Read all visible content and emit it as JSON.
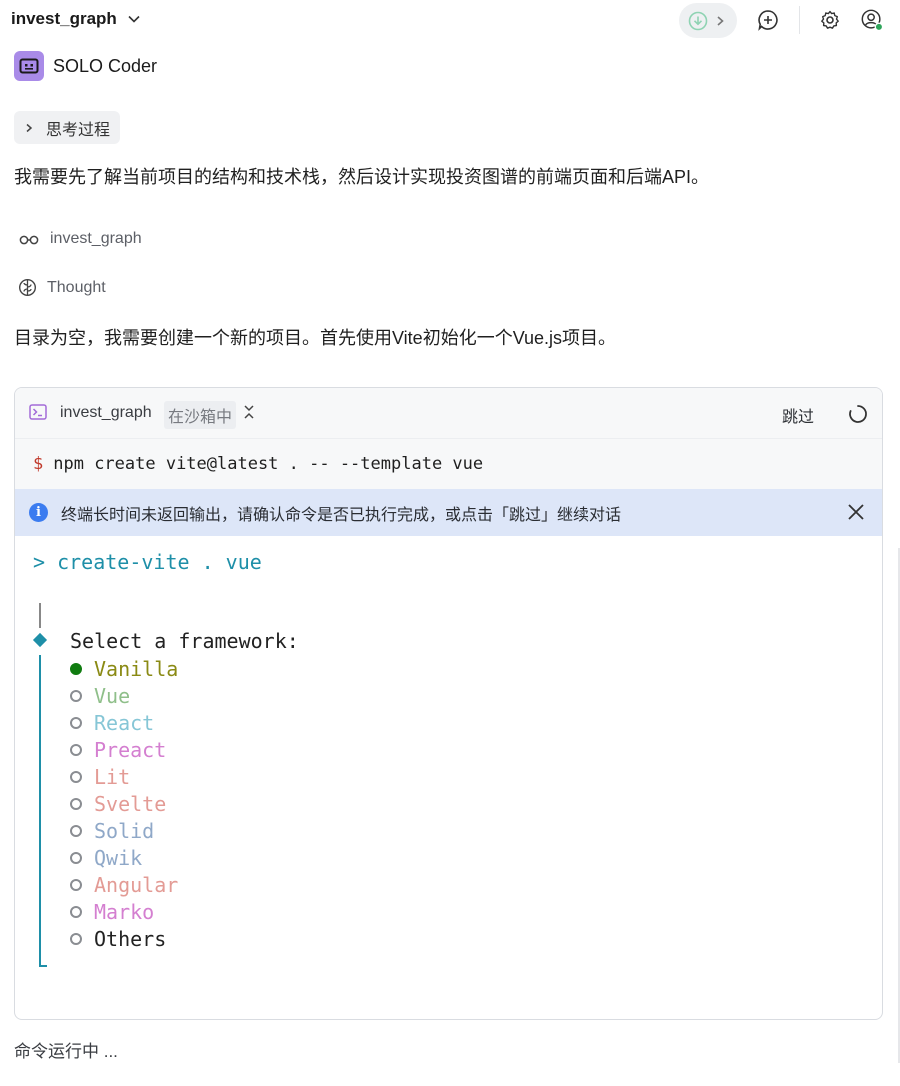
{
  "header": {
    "project_title": "invest_graph",
    "icons": [
      "chevron-down-icon",
      "download-icon",
      "chevron-right-icon",
      "new-chat-icon",
      "gear-icon",
      "user-icon"
    ],
    "status_dot_color": "#2fa55b"
  },
  "agent": {
    "name": "SOLO Coder",
    "avatar_color": "#a98be8"
  },
  "thinking": {
    "label": "思考过程"
  },
  "messages": {
    "first": "我需要先了解当前项目的结构和技术栈，然后设计实现投资图谱的前端页面和后端API。",
    "second": "目录为空，我需要创建一个新的项目。首先使用Vite初始化一个Vue.js项目。"
  },
  "meta": {
    "view_label": "invest_graph",
    "thought_label": "Thought"
  },
  "terminal": {
    "title": "invest_graph",
    "sandbox_tag": "在沙箱中",
    "skip_label": "跳过",
    "command_prefix": "$",
    "command": "npm create vite@latest . -- --template vue",
    "info_message": "终端长时间未返回输出，请确认命令是否已执行完成，或点击「跳过」继续对话",
    "prompt_line": "> create-vite . vue",
    "select_label": "Select a framework:",
    "options": [
      {
        "label": "Vanilla",
        "color": "#8a8a14",
        "selected": true
      },
      {
        "label": "Vue",
        "color": "#8fbf8a",
        "selected": false
      },
      {
        "label": "React",
        "color": "#86c6d6",
        "selected": false
      },
      {
        "label": "Preact",
        "color": "#d47fd0",
        "selected": false
      },
      {
        "label": "Lit",
        "color": "#e39b95",
        "selected": false
      },
      {
        "label": "Svelte",
        "color": "#e39b95",
        "selected": false
      },
      {
        "label": "Solid",
        "color": "#8fa8c8",
        "selected": false
      },
      {
        "label": "Qwik",
        "color": "#8fa8c8",
        "selected": false
      },
      {
        "label": "Angular",
        "color": "#e39b95",
        "selected": false
      },
      {
        "label": "Marko",
        "color": "#d47fd0",
        "selected": false
      },
      {
        "label": "Others",
        "color": "#222222",
        "selected": false
      }
    ]
  },
  "footer": {
    "status": "命令运行中 ..."
  }
}
